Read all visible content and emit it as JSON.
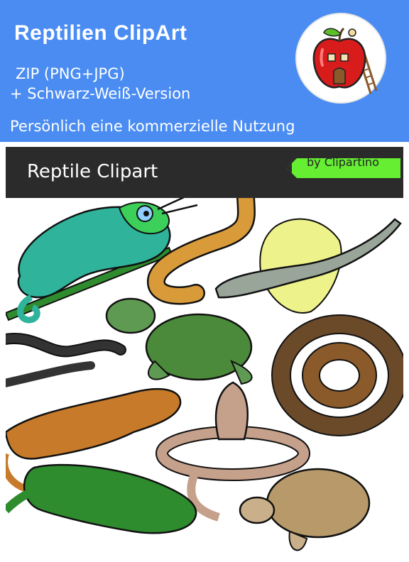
{
  "header": {
    "title": "Reptilien ClipArt",
    "line1": "ZIP (PNG+JPG)",
    "line2": "+ Schwarz-Weiß-Version",
    "line3": "Persönlich eine kommerzielle Nutzung",
    "background_color": "#4a8cf2"
  },
  "banner": {
    "label": "Reptile Clipart",
    "tag": "by Clipartino",
    "tag_color": "#66ee33"
  },
  "logo": {
    "icon": "apple-house-icon"
  },
  "illustrations": [
    "chameleon-icon",
    "worm-icon",
    "flying-lizard-icon",
    "sea-turtle-icon",
    "black-snake-icon",
    "python-icon",
    "iguana-icon",
    "cobra-icon",
    "crocodile-icon",
    "tortoise-icon"
  ]
}
